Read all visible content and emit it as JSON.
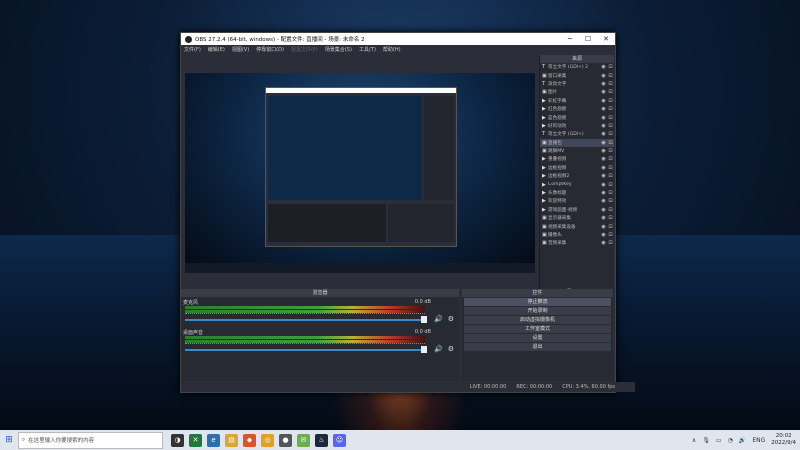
{
  "window": {
    "title": "OBS 27.2.4 (64-bit, windows) - 配置文件: 直播间 - 场景: 未命名 2",
    "minimize": "─",
    "maximize": "☐",
    "close": "✕"
  },
  "menu": [
    "文件(F)",
    "编辑(E)",
    "视图(V)",
    "停靠窗口(D)",
    "配置文件(P)",
    "场景集合(S)",
    "工具(T)",
    "帮助(H)"
  ],
  "sources": {
    "title": "来源",
    "items": [
      {
        "type": "T",
        "name": "等立文字 (GDI+) 2"
      },
      {
        "type": "▣",
        "name": "窗口采集"
      },
      {
        "type": "T",
        "name": "滚动文字"
      },
      {
        "type": "▣",
        "name": "图片"
      },
      {
        "type": "▶",
        "name": "彩虹字幕"
      },
      {
        "type": "▶",
        "name": "红色翅膀"
      },
      {
        "type": "▶",
        "name": "蓝色翅膀"
      },
      {
        "type": "▶",
        "name": "好的动效"
      },
      {
        "type": "T",
        "name": "等立文字 (GDI+)"
      },
      {
        "type": "▣",
        "name": "直播包",
        "selected": true
      },
      {
        "type": "▣",
        "name": "跳舞MV"
      },
      {
        "type": "▶",
        "name": "重叠视频"
      },
      {
        "type": "▶",
        "name": "边框视频"
      },
      {
        "type": "▶",
        "name": "边框视频2"
      },
      {
        "type": "▶",
        "name": "ComptKey"
      },
      {
        "type": "▶",
        "name": "头像标题"
      },
      {
        "type": "▶",
        "name": "欢迎特效"
      },
      {
        "type": "▶",
        "name": "游戏画面-视频"
      },
      {
        "type": "▣",
        "name": "显示器采集"
      },
      {
        "type": "▣",
        "name": "视频采集设备"
      },
      {
        "type": "▣",
        "name": "摄像头"
      },
      {
        "type": "▣",
        "name": "音频采集"
      }
    ],
    "tools": [
      "+",
      "−",
      "⚙",
      "∧",
      "∨"
    ]
  },
  "mixer": {
    "title": "混音器",
    "channels": [
      {
        "name": "麦克风",
        "db": "0.0 dB"
      },
      {
        "name": "桌面声音",
        "db": "0.0 dB"
      }
    ],
    "vol_icon": "🔊",
    "gear_icon": "⚙"
  },
  "controls": {
    "title": "控件",
    "buttons": [
      "停止推流",
      "开始录制",
      "启动虚拟摄像机",
      "工作室模式",
      "设置",
      "退出"
    ]
  },
  "status": {
    "live": "LIVE: 00:00:00",
    "rec": "REC: 00:00:00",
    "cpu": "CPU: 3.4%, 60.00 fps"
  },
  "taskbar": {
    "search_placeholder": "在这里输入你要搜索的内容",
    "lang": "ENG",
    "time": "20:02",
    "date": "2022/9/4"
  }
}
